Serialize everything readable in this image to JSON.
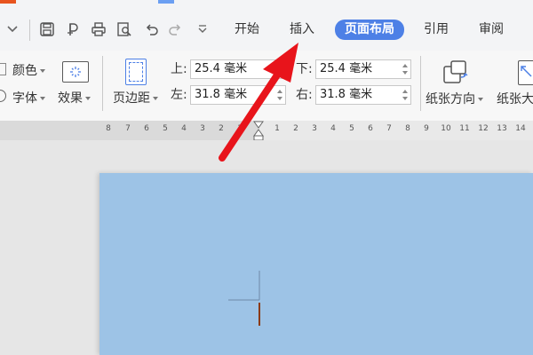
{
  "menu": {
    "tabs": [
      {
        "label": "开始"
      },
      {
        "label": "插入"
      },
      {
        "label": "页面布局",
        "active": true
      },
      {
        "label": "引用"
      },
      {
        "label": "审阅"
      }
    ]
  },
  "ribbon": {
    "color_label": "颜色",
    "font_label": "字体",
    "effects_label": "效果",
    "margins_label": "页边距",
    "margin_top_label": "上:",
    "margin_top_value": "25.4 毫米",
    "margin_bottom_label": "下:",
    "margin_bottom_value": "25.4 毫米",
    "margin_left_label": "左:",
    "margin_left_value": "31.8 毫米",
    "margin_right_label": "右:",
    "margin_right_value": "31.8 毫米",
    "orientation_label": "纸张方向",
    "size_label": "纸张大"
  },
  "ruler": {
    "left_numbers": [
      "8",
      "7",
      "6",
      "5",
      "4",
      "3",
      "2",
      "1"
    ],
    "right_numbers": [
      "1",
      "2",
      "3",
      "4",
      "5",
      "6",
      "7",
      "8",
      "9",
      "10",
      "11",
      "12",
      "13",
      "14"
    ]
  },
  "colors": {
    "accent": "#4d80e6",
    "page_background": "#9dc3e6",
    "annotation_arrow": "#e8141b",
    "cursor": "#8b3a0e"
  },
  "icons": {
    "dropdown": "chevron-down-icon",
    "save": "save-icon",
    "print": "print-icon",
    "preview": "print-preview-icon",
    "undo": "undo-icon",
    "redo": "redo-icon"
  }
}
